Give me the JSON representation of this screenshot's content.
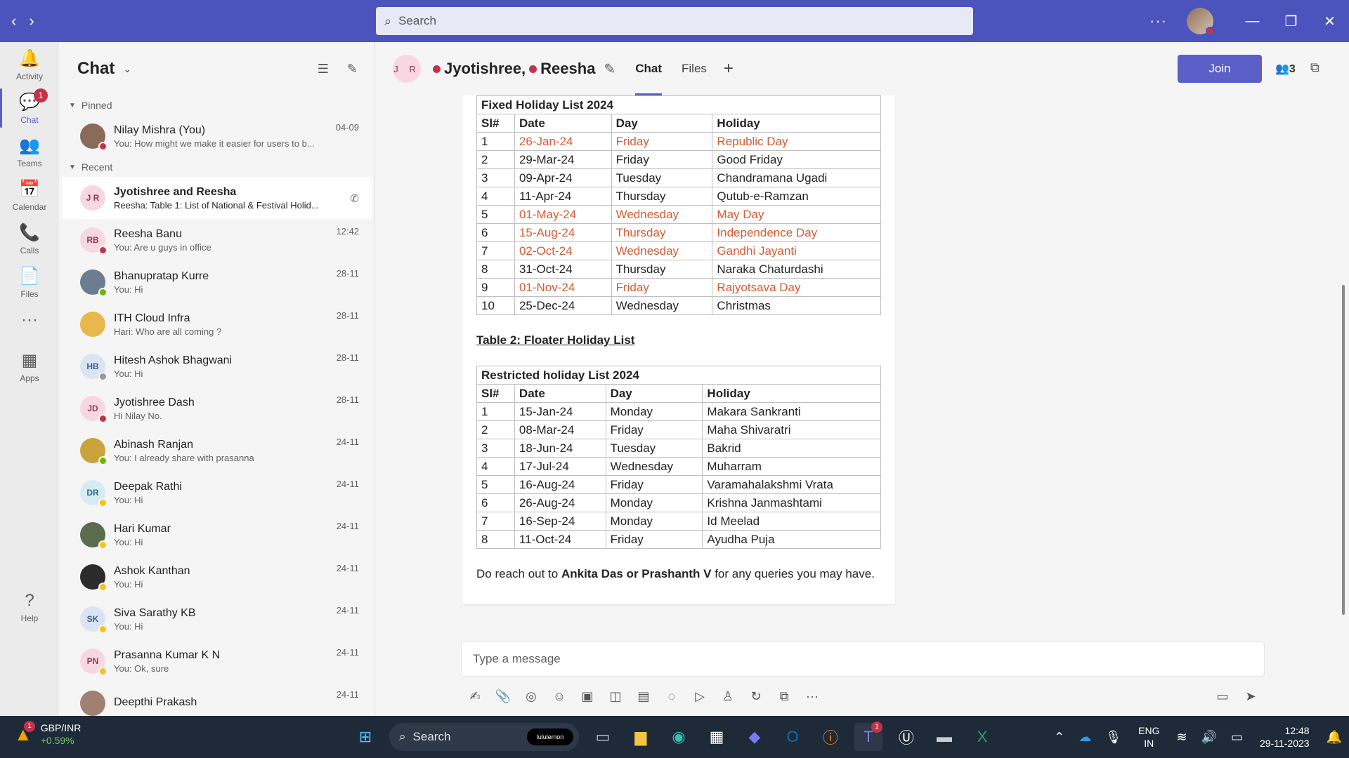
{
  "titlebar": {
    "search_placeholder": "Search",
    "more": "···"
  },
  "rail": [
    {
      "id": "activity",
      "label": "Activity",
      "icon": "🔔"
    },
    {
      "id": "chat",
      "label": "Chat",
      "icon": "💬",
      "badge": "1"
    },
    {
      "id": "teams",
      "label": "Teams",
      "icon": "👥"
    },
    {
      "id": "calendar",
      "label": "Calendar",
      "icon": "📅"
    },
    {
      "id": "calls",
      "label": "Calls",
      "icon": "📞"
    },
    {
      "id": "files",
      "label": "Files",
      "icon": "📄"
    },
    {
      "id": "more",
      "label": "",
      "icon": "···"
    },
    {
      "id": "apps",
      "label": "Apps",
      "icon": "▦"
    },
    {
      "id": "help",
      "label": "Help",
      "icon": "?"
    }
  ],
  "list": {
    "title": "Chat",
    "pinned_label": "Pinned",
    "recent_label": "Recent",
    "pinned": [
      {
        "name": "Nilay Mishra (You)",
        "preview": "You: How might we make it easier for users to b...",
        "time": "04-09",
        "initials": "",
        "avatar_bg": "#8a6a58",
        "status": "#c4314b"
      }
    ],
    "recent": [
      {
        "name": "Jyotishree and Reesha",
        "preview": "Reesha: Table 1: List of National & Festival Holid...",
        "time": "",
        "initials": "J R",
        "avatar_bg": "#f8d7e3",
        "avatar_fg": "#8b3b5b",
        "status": "",
        "selected": true
      },
      {
        "name": "Reesha Banu",
        "preview": "You: Are u guys in office",
        "time": "12:42",
        "initials": "RB",
        "avatar_bg": "#f8d7e3",
        "avatar_fg": "#8b3b5b",
        "status": "#c4314b"
      },
      {
        "name": "Bhanupratap Kurre",
        "preview": "You: Hi",
        "time": "28-11",
        "initials": "",
        "avatar_bg": "#6b7d8f",
        "status": "#6bb700"
      },
      {
        "name": "ITH Cloud Infra",
        "preview": "Hari: Who are all coming ?",
        "time": "28-11",
        "initials": "",
        "avatar_bg": "#e8b84a",
        "status": ""
      },
      {
        "name": "Hitesh Ashok Bhagwani",
        "preview": "You: Hi",
        "time": "28-11",
        "initials": "HB",
        "avatar_bg": "#dbe4f3",
        "avatar_fg": "#3b5b8b",
        "status": "#999999"
      },
      {
        "name": "Jyotishree Dash",
        "preview": "Hi Nilay No.",
        "time": "28-11",
        "initials": "JD",
        "avatar_bg": "#f8d7e3",
        "avatar_fg": "#8b3b5b",
        "status": "#c4314b"
      },
      {
        "name": "Abinash Ranjan",
        "preview": "You: I already share with prasanna",
        "time": "24-11",
        "initials": "",
        "avatar_bg": "#c9a43a",
        "status": "#6bb700"
      },
      {
        "name": "Deepak Rathi",
        "preview": "You: Hi",
        "time": "24-11",
        "initials": "DR",
        "avatar_bg": "#d6ecf5",
        "avatar_fg": "#2b6b8b",
        "status": "#f8c21d"
      },
      {
        "name": "Hari Kumar",
        "preview": "You: Hi",
        "time": "24-11",
        "initials": "",
        "avatar_bg": "#5b6b4b",
        "status": "#f8c21d"
      },
      {
        "name": "Ashok Kanthan",
        "preview": "You: Hi",
        "time": "24-11",
        "initials": "",
        "avatar_bg": "#2b2b2b",
        "status": "#f8c21d"
      },
      {
        "name": "Siva Sarathy KB",
        "preview": "You: Hi",
        "time": "24-11",
        "initials": "SK",
        "avatar_bg": "#dbe4f3",
        "avatar_fg": "#3b5b8b",
        "status": "#f8c21d"
      },
      {
        "name": "Prasanna Kumar K N",
        "preview": "You: Ok, sure",
        "time": "24-11",
        "initials": "PN",
        "avatar_bg": "#f8d7e3",
        "avatar_fg": "#8b3b5b",
        "status": "#f8c21d"
      },
      {
        "name": "Deepthi Prakash",
        "preview": "",
        "time": "24-11",
        "initials": "",
        "avatar_bg": "#a08070",
        "status": ""
      }
    ]
  },
  "conversation": {
    "avatar_initials": "J R",
    "name1": "Jyotishree,",
    "name2": "Reesha",
    "tab_chat": "Chat",
    "tab_files": "Files",
    "join": "Join",
    "participants": "3",
    "table1_caption": "Fixed Holiday List 2024",
    "table1_headers": [
      "Sl#",
      "Date",
      "Day",
      "Holiday"
    ],
    "table1_rows": [
      {
        "c": [
          "1",
          "26-Jan-24",
          "Friday",
          "Republic Day"
        ],
        "red": true
      },
      {
        "c": [
          "2",
          "29-Mar-24",
          "Friday",
          "Good Friday"
        ],
        "red": false
      },
      {
        "c": [
          "3",
          "09-Apr-24",
          "Tuesday",
          "Chandramana Ugadi"
        ],
        "red": false
      },
      {
        "c": [
          "4",
          "11-Apr-24",
          "Thursday",
          "Qutub-e-Ramzan"
        ],
        "red": false
      },
      {
        "c": [
          "5",
          "01-May-24",
          "Wednesday",
          "May Day"
        ],
        "red": true
      },
      {
        "c": [
          "6",
          "15-Aug-24",
          "Thursday",
          "Independence Day"
        ],
        "red": true
      },
      {
        "c": [
          "7",
          "02-Oct-24",
          "Wednesday",
          "Gandhi Jayanti"
        ],
        "red": true
      },
      {
        "c": [
          "8",
          "31-Oct-24",
          "Thursday",
          "Naraka Chaturdashi"
        ],
        "red": false
      },
      {
        "c": [
          "9",
          "01-Nov-24",
          "Friday",
          "Rajyotsava Day"
        ],
        "red": true
      },
      {
        "c": [
          "10",
          "25-Dec-24",
          "Wednesday",
          "Christmas"
        ],
        "red": false
      }
    ],
    "table2_title": "Table 2: Floater Holiday List",
    "table2_caption": "Restricted holiday List 2024",
    "table2_headers": [
      "Sl#",
      "Date",
      "Day",
      "Holiday"
    ],
    "table2_rows": [
      [
        "1",
        "15-Jan-24",
        "Monday",
        "Makara Sankranti"
      ],
      [
        "2",
        "08-Mar-24",
        "Friday",
        "Maha Shivaratri"
      ],
      [
        "3",
        "18-Jun-24",
        "Tuesday",
        "Bakrid"
      ],
      [
        "4",
        "17-Jul-24",
        "Wednesday",
        "Muharram"
      ],
      [
        "5",
        "16-Aug-24",
        "Friday",
        "Varamahalakshmi Vrata"
      ],
      [
        "6",
        "26-Aug-24",
        "Monday",
        "Krishna Janmashtami"
      ],
      [
        "7",
        "16-Sep-24",
        "Monday",
        "Id Meelad"
      ],
      [
        "8",
        "11-Oct-24",
        "Friday",
        "Ayudha Puja"
      ]
    ],
    "closing_pre": "Do reach out to ",
    "closing_bold": "Ankita Das or Prashanth V",
    "closing_post": " for any queries you may have.",
    "compose_placeholder": "Type a message"
  },
  "taskbar": {
    "ticker_name": "GBP/INR",
    "ticker_change": "+0.59%",
    "ticker_badge": "1",
    "search": "Search",
    "search_pill": "lululemon",
    "teams_badge": "1",
    "lang1": "ENG",
    "lang2": "IN",
    "time": "12:48",
    "date": "29-11-2023"
  }
}
